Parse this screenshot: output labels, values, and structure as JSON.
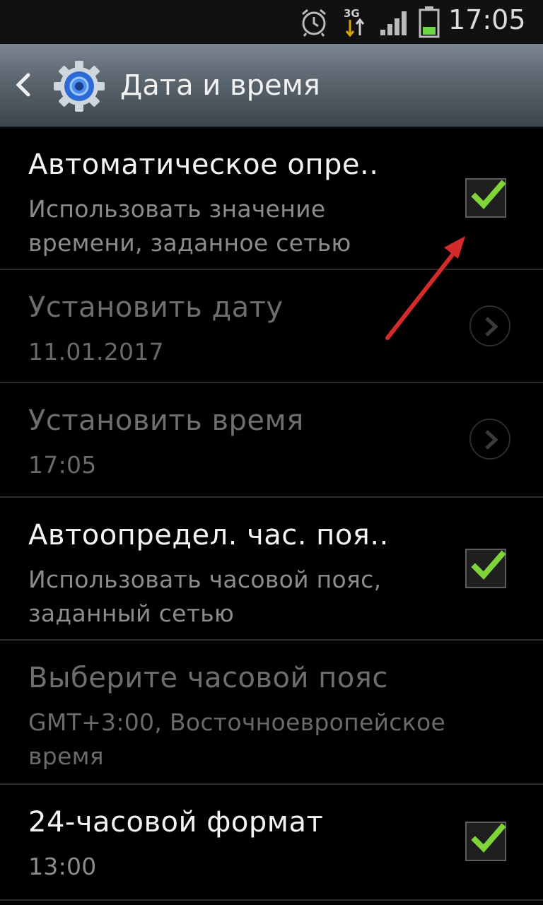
{
  "status_bar": {
    "time": "17:05",
    "network": "3G",
    "icons": [
      "alarm-icon",
      "data-transfer-icon",
      "signal-icon",
      "battery-icon"
    ]
  },
  "action_bar": {
    "title": "Дата и время",
    "back_icon": "chevron-left-icon",
    "app_icon": "gear-icon"
  },
  "items": [
    {
      "title": "Автоматическое опре..",
      "subtitle": "Использовать значение времени, заданное сетью",
      "control": "checkbox",
      "checked": true,
      "enabled": true
    },
    {
      "title": "Установить дату",
      "subtitle": "11.01.2017",
      "control": "chevron",
      "enabled": false
    },
    {
      "title": "Установить время",
      "subtitle": "17:05",
      "control": "chevron",
      "enabled": false
    },
    {
      "title": "Автоопредел. час. поя..",
      "subtitle": "Использовать часовой пояс, заданный сетью",
      "control": "checkbox",
      "checked": true,
      "enabled": true
    },
    {
      "title": "Выберите часовой пояс",
      "subtitle": "GMT+3:00, Восточноевропейское время",
      "control": "none",
      "enabled": false
    },
    {
      "title": "24-часовой формат",
      "subtitle": "13:00",
      "control": "checkbox",
      "checked": true,
      "enabled": true
    }
  ],
  "colors": {
    "check": "#7fd43a",
    "annotation_arrow": "#d42a2a",
    "action_bar": "#5b656e"
  }
}
